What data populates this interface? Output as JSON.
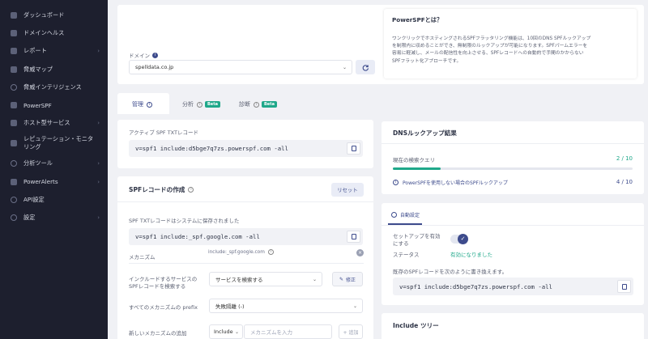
{
  "sidebar": {
    "items": [
      {
        "label": "ダッシュボード",
        "icon": "grid-icon",
        "chevron": false
      },
      {
        "label": "ドメインヘルス",
        "icon": "shield-icon",
        "chevron": false
      },
      {
        "label": "レポート",
        "icon": "document-icon",
        "chevron": true
      },
      {
        "label": "脅威マップ",
        "icon": "map-icon",
        "chevron": false
      },
      {
        "label": "脅威インテリジェンス",
        "icon": "radar-icon",
        "chevron": false
      },
      {
        "label": "PowerSPF",
        "icon": "bolt-icon",
        "chevron": false
      },
      {
        "label": "ホスト型サービス",
        "icon": "server-icon",
        "chevron": true
      },
      {
        "label": "レピュテーション・モニタリング",
        "icon": "monitor-icon",
        "chevron": false
      },
      {
        "label": "分析ツール",
        "icon": "tool-icon",
        "chevron": true
      },
      {
        "label": "PowerAlerts",
        "icon": "bell-icon",
        "chevron": true
      },
      {
        "label": "API設定",
        "icon": "globe-icon",
        "chevron": false
      },
      {
        "label": "設定",
        "icon": "gear-icon",
        "chevron": true
      }
    ]
  },
  "domain": {
    "label": "ドメイン",
    "value": "spelldata.co.jp"
  },
  "about": {
    "title": "PowerSPFとは？",
    "lines": [
      "ワンクリックでホスティングされるSPFフラッタリング機能は、10回のDNS SPFルックアップ",
      "を制限内に収めることができ、無制限のルックアップが可能になります。SPFパームエラーを",
      "容易に軽減し、メールの配信性を向上させる、SPFレコードへの自動的で手間のかからない",
      "SPFフラット化アプローチです。"
    ]
  },
  "tabs": [
    {
      "label": "管理",
      "badge": ""
    },
    {
      "label": "分析",
      "badge": "Beta"
    },
    {
      "label": "診断",
      "badge": "Beta"
    }
  ],
  "active_record": {
    "label": "アクティブ SPF TXTレコード",
    "value": "v=spf1 include:d5bge7q7zs.powerspf.com -all"
  },
  "create": {
    "title": "SPFレコードの作成",
    "reset_label": "リセット",
    "saved_note": "SPF TXTレコードはシステムに保存されました",
    "record_value": "v=spf1 include:_spf.google.com -all",
    "mechanism_label": "メカニズム",
    "mechanism_value": "include:_spf.google.com",
    "include_label_1": "インクルードするサービスの",
    "include_label_2": "SPFレコードを検索する",
    "service_placeholder": "サービスを検索する",
    "edit_label": "修正",
    "prefix_label": "すべてのメカニズムの prefix",
    "prefix_value": "失敗隔離 (-)",
    "new_mech_label": "新しいメカニズムの追加",
    "new_mech_type": "Include",
    "new_mech_placeholder": "メカニズムを入力",
    "add_label": "+ 追加"
  },
  "dns": {
    "title": "DNSルックアップ結果",
    "current_label": "現在の検索クエリ",
    "current_value": "2 / 10",
    "current_progress": 0.2,
    "without_label": "PowerSPFを使用しない場合のSPFルックアップ",
    "without_value": "4 / 10"
  },
  "auto": {
    "tag": "自動設定",
    "toggle_label_1": "セットアップを有効",
    "toggle_label_2": "にする",
    "toggle_on": true,
    "status_label": "ステータス",
    "status_value": "有効になりました",
    "replace_note": "既存のSPFレコードを次のように書き換えます。",
    "record_value": "v=spf1 include:d5bge7q7zs.powerspf.com -all"
  },
  "include_tree": {
    "title": "Include ツリー"
  },
  "colors": {
    "accent": "#3d4b8c",
    "green": "#1fa88a",
    "sidebar": "#1d1f2e"
  }
}
